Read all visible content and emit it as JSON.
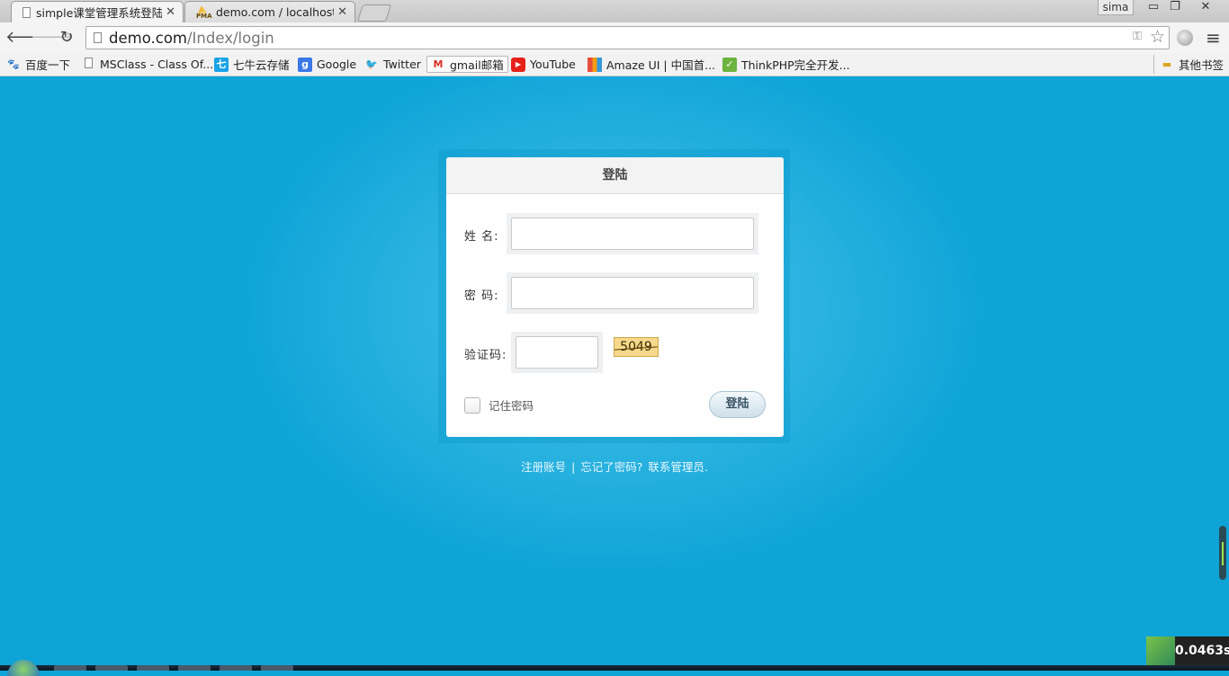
{
  "browser": {
    "tabs": [
      {
        "title": "simple课堂管理系统登陆",
        "active": true,
        "icon": "document-icon"
      },
      {
        "title": "demo.com / localhost /",
        "active": false,
        "icon": "phpmyadmin-icon"
      }
    ],
    "user": "sima",
    "window_controls": {
      "minimize": "▭",
      "restore": "❐",
      "close": "✕"
    },
    "url_host": "demo.com",
    "url_path": "/Index/login",
    "nav": {
      "back": "🡐",
      "forward": "🡒",
      "reload": "↻"
    },
    "bookmarks": [
      {
        "label": "百度一下",
        "icon": "baidu-paw-icon",
        "color": "#2932e1"
      },
      {
        "label": "MSClass - Class Of...",
        "icon": "document-icon",
        "color": "#888888"
      },
      {
        "label": "七牛云存储",
        "icon": "qiniu-icon",
        "color": "#1aa3e8"
      },
      {
        "label": "Google",
        "icon": "google-icon",
        "color": "#3b78e7"
      },
      {
        "label": "Twitter",
        "icon": "twitter-bird-icon",
        "color": "#55acee"
      },
      {
        "label": "gmail邮箱",
        "icon": "gmail-icon",
        "color": "#d93025"
      },
      {
        "label": "YouTube",
        "icon": "youtube-icon",
        "color": "#e62117"
      },
      {
        "label": "Amaze UI | 中国首...",
        "icon": "amazeui-icon",
        "color": "#e84c3d"
      },
      {
        "label": "ThinkPHP完全开发...",
        "icon": "thinkphp-icon",
        "color": "#6cb33f"
      }
    ],
    "other_bookmarks": "其他书签"
  },
  "login": {
    "title": "登陆",
    "name_label": "姓  名:",
    "password_label": "密  码:",
    "captcha_label": "验证码:",
    "captcha_text": "5049",
    "remember_label": "记住密码",
    "submit_label": "登陆",
    "footer": {
      "register": "注册账号",
      "separator": "|",
      "forgot": "忘记了密码?",
      "contact": "联系管理员."
    }
  },
  "timer": "0.0463s",
  "colors": {
    "page_bg": "#0ea4d7",
    "page_glow": "#5fcbea"
  }
}
